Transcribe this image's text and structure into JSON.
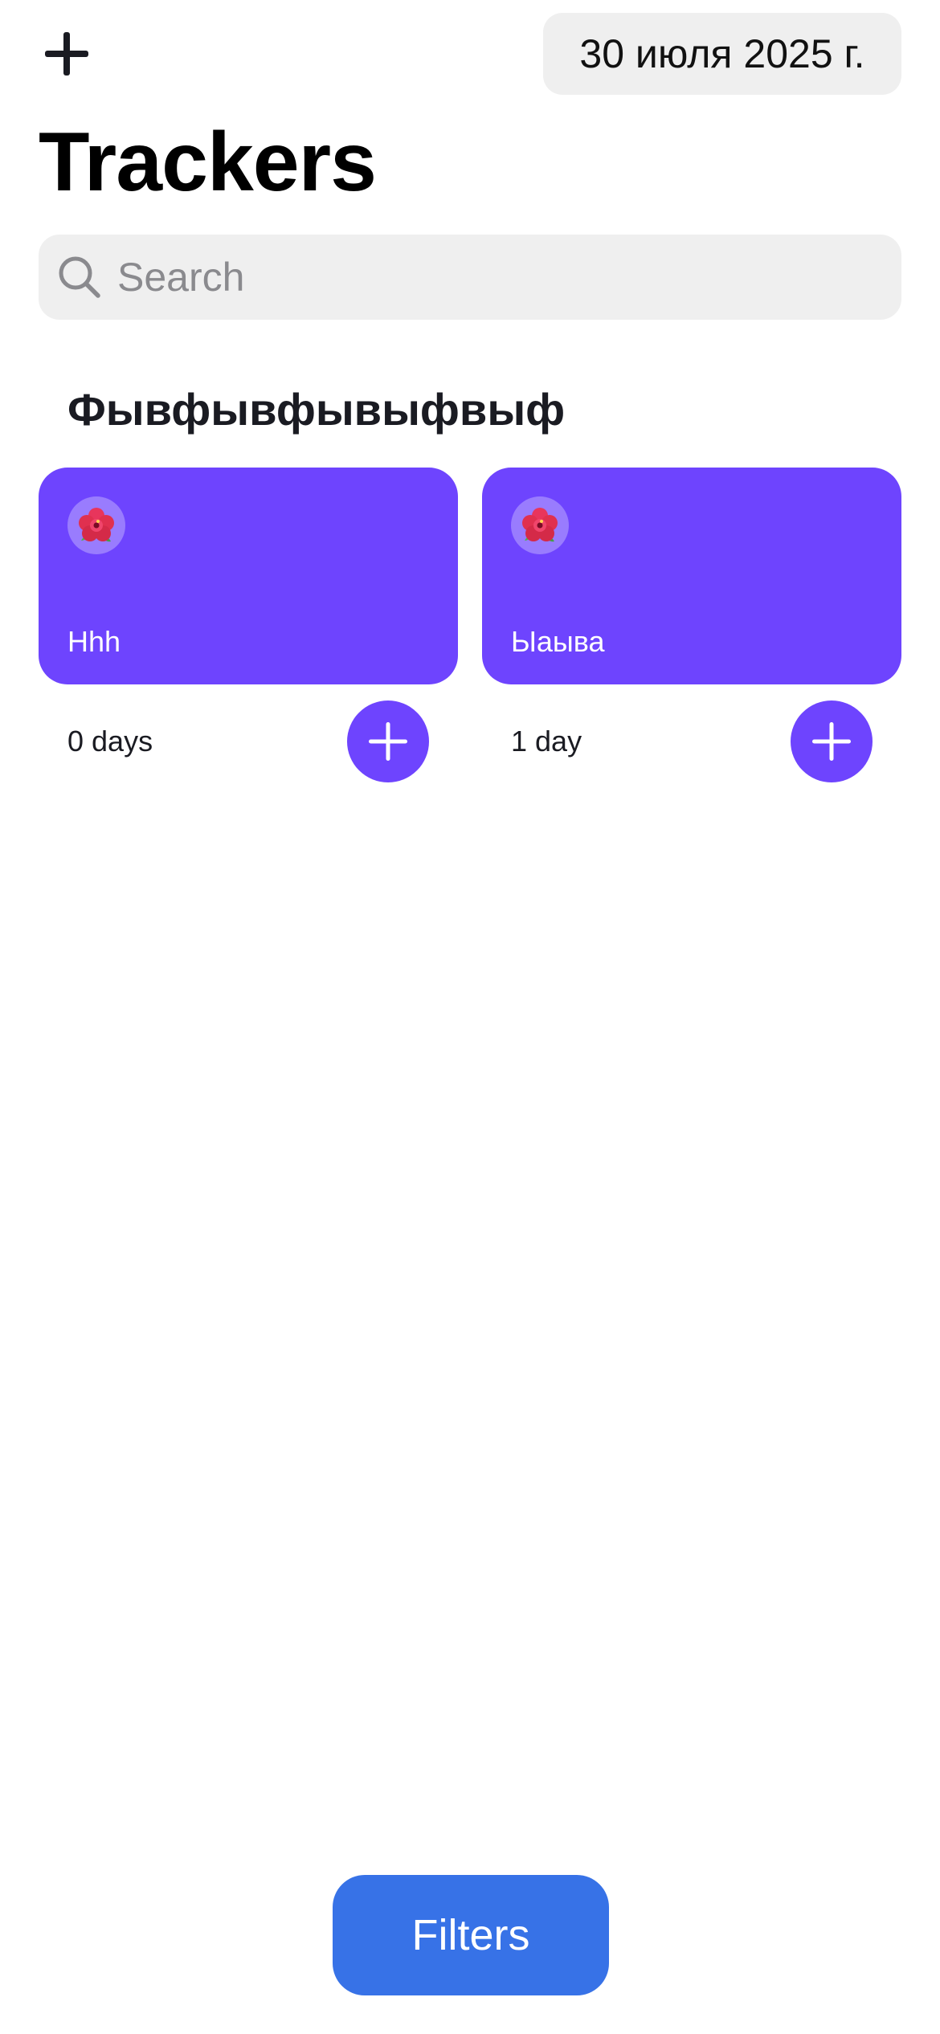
{
  "header": {
    "add_icon": "plus-icon",
    "date": "30 июля 2025 г."
  },
  "page_title": "Trackers",
  "search": {
    "icon": "magnifying-glass-icon",
    "placeholder": "Search",
    "value": ""
  },
  "categories": [
    {
      "title": "Фывфывфывыфвыф",
      "trackers": [
        {
          "emoji": "🌺",
          "name": "Hhh",
          "days": "0 days",
          "color": "#6e44fe",
          "button_icon": "plus-icon"
        },
        {
          "emoji": "🌺",
          "name": "Ыаыва",
          "days": "1 day",
          "color": "#6e44fe",
          "button_icon": "plus-icon"
        }
      ]
    }
  ],
  "filters_button": {
    "label": "Filters",
    "color": "#3772e7"
  }
}
